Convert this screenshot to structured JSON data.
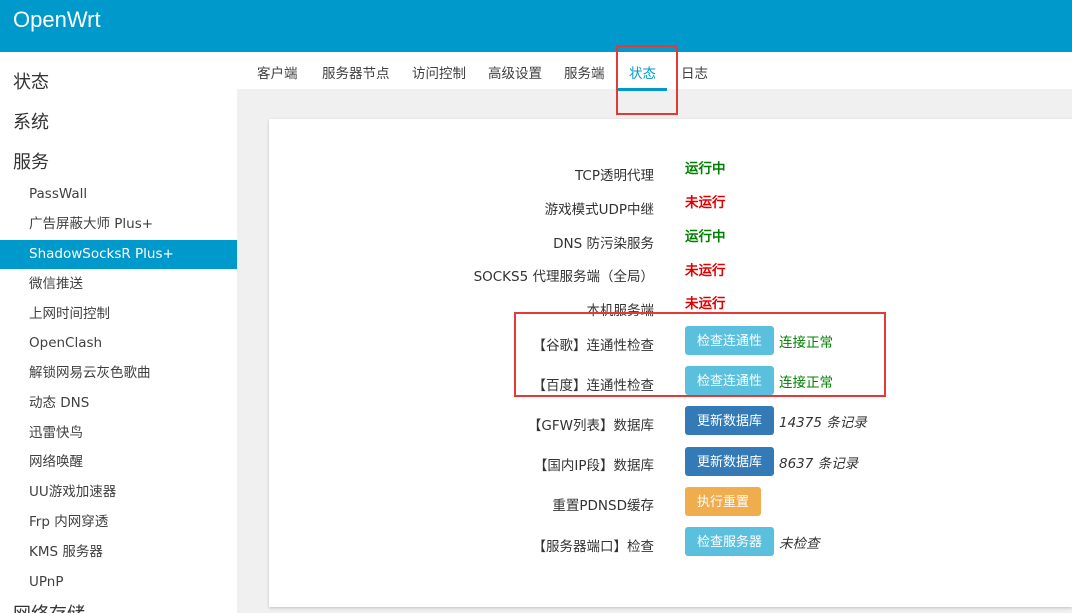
{
  "header": {
    "brand": "OpenWrt"
  },
  "sidebar": {
    "categories": [
      "状态",
      "系统",
      "服务"
    ],
    "items": [
      {
        "label": "PassWall"
      },
      {
        "label": "广告屏蔽大师 Plus+"
      },
      {
        "label": "ShadowSocksR Plus+"
      },
      {
        "label": "微信推送"
      },
      {
        "label": "上网时间控制"
      },
      {
        "label": "OpenClash"
      },
      {
        "label": "解锁网易云灰色歌曲"
      },
      {
        "label": "动态 DNS"
      },
      {
        "label": "迅雷快鸟"
      },
      {
        "label": "网络唤醒"
      },
      {
        "label": "UU游戏加速器"
      },
      {
        "label": "Frp 内网穿透"
      },
      {
        "label": "KMS 服务器"
      },
      {
        "label": "UPnP"
      }
    ],
    "partial_category": "网络存储"
  },
  "tabs": [
    {
      "label": "客户端"
    },
    {
      "label": "服务器节点"
    },
    {
      "label": "访问控制"
    },
    {
      "label": "高级设置"
    },
    {
      "label": "服务端"
    },
    {
      "label": "状态"
    },
    {
      "label": "日志"
    }
  ],
  "status_rows": [
    {
      "label": "TCP透明代理",
      "status": "运行中"
    },
    {
      "label": "游戏模式UDP中继",
      "status": "未运行"
    },
    {
      "label": "DNS 防污染服务",
      "status": "运行中"
    },
    {
      "label": "SOCKS5 代理服务端（全局）",
      "status": "未运行"
    },
    {
      "label": "本机服务端",
      "status": "未运行"
    }
  ],
  "action_rows": [
    {
      "label": "【谷歌】连通性检查",
      "button": "检查连通性",
      "result": "连接正常"
    },
    {
      "label": "【百度】连通性检查",
      "button": "检查连通性",
      "result": "连接正常"
    },
    {
      "label": "【GFW列表】数据库",
      "button": "更新数据库",
      "result": "14375 条记录"
    },
    {
      "label": "【国内IP段】数据库",
      "button": "更新数据库",
      "result": "8637 条记录"
    },
    {
      "label": "重置PDNSD缓存",
      "button": "执行重置",
      "result": ""
    },
    {
      "label": "【服务器端口】检查",
      "button": "检查服务器",
      "result": "未检查"
    }
  ],
  "colors": {
    "brand": "#0099cc",
    "running": "#008000",
    "stopped": "#e00000",
    "btn_info": "#5bc0de",
    "btn_primary": "#337ab7",
    "btn_warning": "#f0ad4e",
    "highlight": "#e53935"
  }
}
